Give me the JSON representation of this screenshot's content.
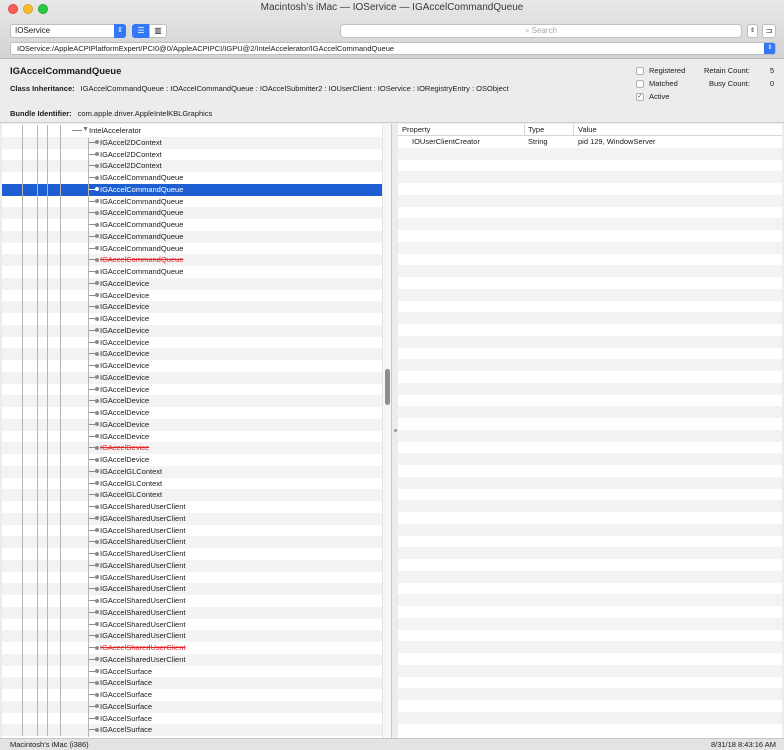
{
  "window": {
    "title": "Macintosh’s iMac — IOService — IGAccelCommandQueue"
  },
  "toolbar": {
    "plane": "IOService",
    "search_placeholder": "Search",
    "path": "IOService:/AppleACPIPlatformExpert/PCI0@0/AppleACPIPCI/IGPU@2/IntelAccelerator/IGAccelCommandQueue"
  },
  "info": {
    "name": "IGAccelCommandQueue",
    "inheritance_label": "Class Inheritance:",
    "inheritance": "IGAccelCommandQueue : IOAccelCommandQueue : IOAccelSubmitter2 : IOUserClient : IOService : IORegistryEntry : OSObject",
    "bundle_label": "Bundle Identifier:",
    "bundle": "com.apple.driver.AppleIntelKBLGraphics",
    "registered_label": "Registered",
    "registered": false,
    "matched_label": "Matched",
    "matched": false,
    "active_label": "Active",
    "active": true,
    "retain_label": "Retain Count:",
    "retain": "5",
    "busy_label": "Busy Count:",
    "busy": "0"
  },
  "tree": {
    "root": "IntelAccelerator",
    "items": [
      {
        "label": "IGAccel2DContext",
        "selected": false,
        "terminated": false
      },
      {
        "label": "IGAccel2DContext",
        "selected": false,
        "terminated": false
      },
      {
        "label": "IGAccel2DContext",
        "selected": false,
        "terminated": false
      },
      {
        "label": "IGAccelCommandQueue",
        "selected": false,
        "terminated": false
      },
      {
        "label": "IGAccelCommandQueue",
        "selected": true,
        "terminated": false
      },
      {
        "label": "IGAccelCommandQueue",
        "selected": false,
        "terminated": false
      },
      {
        "label": "IGAccelCommandQueue",
        "selected": false,
        "terminated": false
      },
      {
        "label": "IGAccelCommandQueue",
        "selected": false,
        "terminated": false
      },
      {
        "label": "IGAccelCommandQueue",
        "selected": false,
        "terminated": false
      },
      {
        "label": "IGAccelCommandQueue",
        "selected": false,
        "terminated": false
      },
      {
        "label": "IGAccelCommandQueue",
        "selected": false,
        "terminated": true
      },
      {
        "label": "IGAccelCommandQueue",
        "selected": false,
        "terminated": false
      },
      {
        "label": "IGAccelDevice",
        "selected": false,
        "terminated": false
      },
      {
        "label": "IGAccelDevice",
        "selected": false,
        "terminated": false
      },
      {
        "label": "IGAccelDevice",
        "selected": false,
        "terminated": false
      },
      {
        "label": "IGAccelDevice",
        "selected": false,
        "terminated": false
      },
      {
        "label": "IGAccelDevice",
        "selected": false,
        "terminated": false
      },
      {
        "label": "IGAccelDevice",
        "selected": false,
        "terminated": false
      },
      {
        "label": "IGAccelDevice",
        "selected": false,
        "terminated": false
      },
      {
        "label": "IGAccelDevice",
        "selected": false,
        "terminated": false
      },
      {
        "label": "IGAccelDevice",
        "selected": false,
        "terminated": false
      },
      {
        "label": "IGAccelDevice",
        "selected": false,
        "terminated": false
      },
      {
        "label": "IGAccelDevice",
        "selected": false,
        "terminated": false
      },
      {
        "label": "IGAccelDevice",
        "selected": false,
        "terminated": false
      },
      {
        "label": "IGAccelDevice",
        "selected": false,
        "terminated": false
      },
      {
        "label": "IGAccelDevice",
        "selected": false,
        "terminated": false
      },
      {
        "label": "IGAccelDevice",
        "selected": false,
        "terminated": true
      },
      {
        "label": "IGAccelDevice",
        "selected": false,
        "terminated": false
      },
      {
        "label": "IGAccelGLContext",
        "selected": false,
        "terminated": false
      },
      {
        "label": "IGAccelGLContext",
        "selected": false,
        "terminated": false
      },
      {
        "label": "IGAccelGLContext",
        "selected": false,
        "terminated": false
      },
      {
        "label": "IGAccelSharedUserClient",
        "selected": false,
        "terminated": false
      },
      {
        "label": "IGAccelSharedUserClient",
        "selected": false,
        "terminated": false
      },
      {
        "label": "IGAccelSharedUserClient",
        "selected": false,
        "terminated": false
      },
      {
        "label": "IGAccelSharedUserClient",
        "selected": false,
        "terminated": false
      },
      {
        "label": "IGAccelSharedUserClient",
        "selected": false,
        "terminated": false
      },
      {
        "label": "IGAccelSharedUserClient",
        "selected": false,
        "terminated": false
      },
      {
        "label": "IGAccelSharedUserClient",
        "selected": false,
        "terminated": false
      },
      {
        "label": "IGAccelSharedUserClient",
        "selected": false,
        "terminated": false
      },
      {
        "label": "IGAccelSharedUserClient",
        "selected": false,
        "terminated": false
      },
      {
        "label": "IGAccelSharedUserClient",
        "selected": false,
        "terminated": false
      },
      {
        "label": "IGAccelSharedUserClient",
        "selected": false,
        "terminated": false
      },
      {
        "label": "IGAccelSharedUserClient",
        "selected": false,
        "terminated": false
      },
      {
        "label": "IGAccelSharedUserClient",
        "selected": false,
        "terminated": true
      },
      {
        "label": "IGAccelSharedUserClient",
        "selected": false,
        "terminated": false
      },
      {
        "label": "IGAccelSurface",
        "selected": false,
        "terminated": false
      },
      {
        "label": "IGAccelSurface",
        "selected": false,
        "terminated": false
      },
      {
        "label": "IGAccelSurface",
        "selected": false,
        "terminated": false
      },
      {
        "label": "IGAccelSurface",
        "selected": false,
        "terminated": false
      },
      {
        "label": "IGAccelSurface",
        "selected": false,
        "terminated": false
      },
      {
        "label": "IGAccelSurface",
        "selected": false,
        "terminated": false
      }
    ]
  },
  "properties": {
    "headers": [
      "Property",
      "Type",
      "Value"
    ],
    "rows": [
      {
        "property": "IOUserClientCreator",
        "type": "String",
        "value": "pid 129, WindowServer"
      }
    ]
  },
  "status": {
    "left": "Macintosh’s iMac (i386)",
    "right": "8/31/18 8:43:16 AM"
  },
  "colors": {
    "selection": "#1d5fd3",
    "accent": "#3478f6",
    "terminated": "#e0262b"
  }
}
